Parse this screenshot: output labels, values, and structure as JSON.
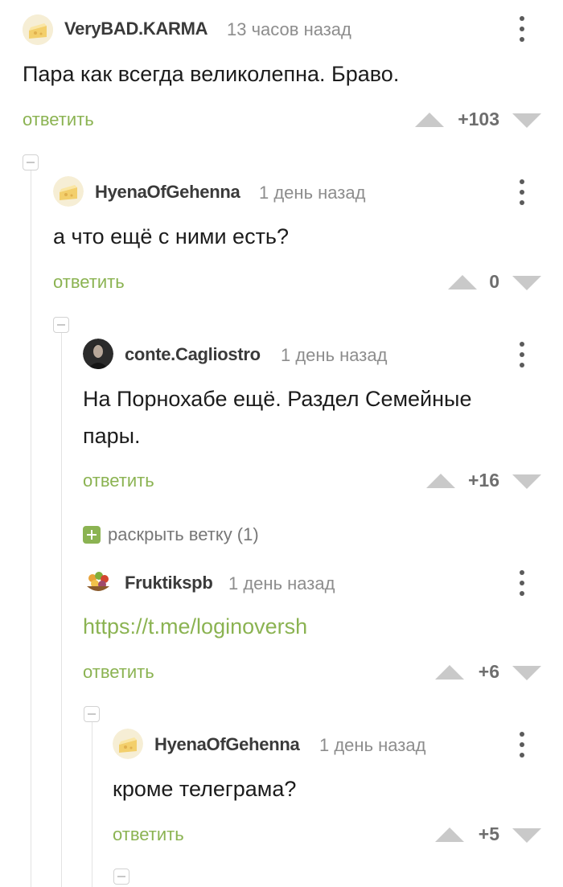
{
  "comments": [
    {
      "author": "VeryBAD.KARMA",
      "time": "13 часов назад",
      "text": "Пара как всегда великолепна. Браво.",
      "reply_label": "ответить",
      "rating": "+103"
    },
    {
      "author": "HyenaOfGehenna",
      "time": "1 день назад",
      "text": "а что ещё с ними есть?",
      "reply_label": "ответить",
      "rating": "0"
    },
    {
      "author": "conte.Cagliostro",
      "time": "1 день назад",
      "text_line1": "На Порнохабе ещё. Раздел Семейные",
      "text_line2": "пары.",
      "reply_label": "ответить",
      "rating": "+16"
    },
    {
      "author": "Fruktikspb",
      "time": "1 день назад",
      "text": "https://t.me/loginoversh",
      "reply_label": "ответить",
      "rating": "+6"
    },
    {
      "author": "HyenaOfGehenna",
      "time": "1 день назад",
      "text": "кроме телеграма?",
      "reply_label": "ответить",
      "rating": "+5"
    }
  ],
  "expand_branch": {
    "label": "раскрыть ветку (1)"
  },
  "colors": {
    "accent": "#8bb352",
    "arrows": "#c9c9c9",
    "author": "#3a3a3a",
    "time": "#8d8d8d"
  }
}
